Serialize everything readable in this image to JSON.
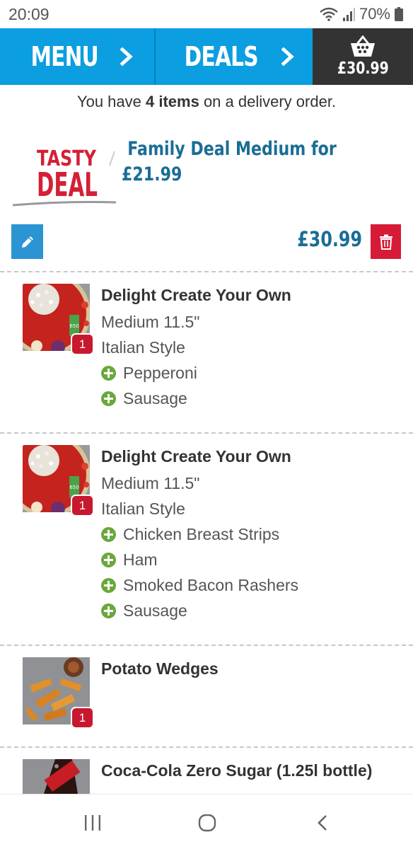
{
  "status_bar": {
    "time": "20:09",
    "battery": "70%",
    "icons": [
      "wifi-icon",
      "signal-icon",
      "battery-icon"
    ]
  },
  "nav": {
    "menu_label": "MENU",
    "deals_label": "DEALS",
    "cart_total": "£30.99",
    "icons": [
      "chevron-right-icon",
      "basket-icon"
    ]
  },
  "summary": {
    "prefix": "You have ",
    "count": "4 items",
    "suffix": " on a delivery order."
  },
  "deal": {
    "logo_line1": "TASTY",
    "logo_line2": "DEAL",
    "title_line1": "Family Deal Medium for",
    "title_line2": "£21.99",
    "price": "£30.99"
  },
  "items": [
    {
      "name": "Delight Create Your Own",
      "size": "Medium 11.5\"",
      "crust": "Italian Style",
      "quantity": "1",
      "thumb_badge": "650",
      "toppings": [
        "Pepperoni",
        "Sausage"
      ]
    },
    {
      "name": "Delight Create Your Own",
      "size": "Medium 11.5\"",
      "crust": "Italian Style",
      "quantity": "1",
      "thumb_badge": "650",
      "toppings": [
        "Chicken Breast Strips",
        "Ham",
        "Smoked Bacon Rashers",
        "Sausage"
      ]
    },
    {
      "name": "Potato Wedges",
      "quantity": "1"
    },
    {
      "name": "Coca-Cola Zero Sugar (1.25l bottle)"
    }
  ],
  "colors": {
    "nav_blue": "#0b9ee0",
    "cart_dark": "#333333",
    "deal_blue": "#1a6d96",
    "delete_red": "#d51b37",
    "badge_red": "#c8182f",
    "topping_green": "#6aa83c",
    "edit_blue": "#2a95d2"
  },
  "system_nav": {
    "icons": [
      "recent-apps-icon",
      "home-icon",
      "back-icon"
    ]
  }
}
